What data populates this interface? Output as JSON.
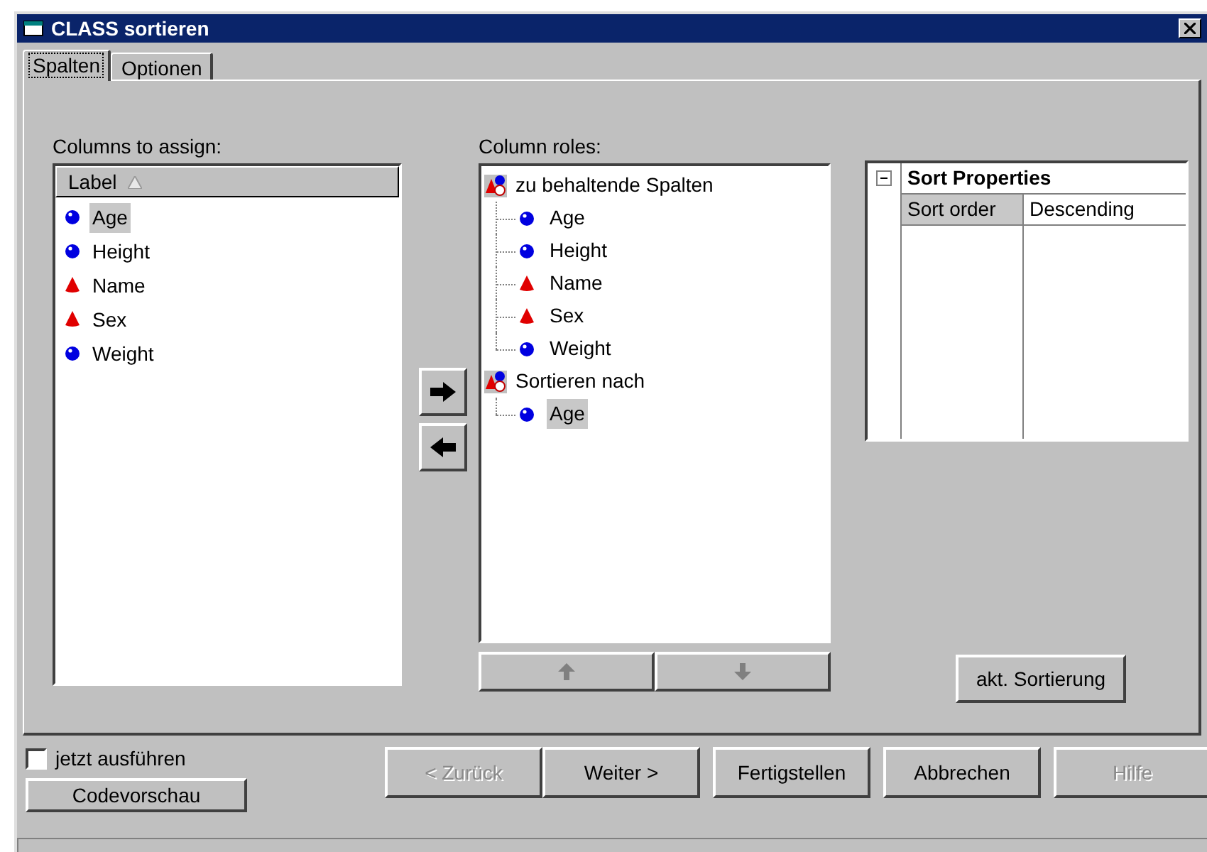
{
  "window": {
    "title": "CLASS sortieren"
  },
  "tabs": [
    {
      "label": "Spalten",
      "selected": true
    },
    {
      "label": "Optionen",
      "selected": false
    }
  ],
  "columns_to_assign": {
    "label": "Columns to assign:",
    "header": "Label",
    "items": [
      {
        "label": "Age",
        "kind": "numeric",
        "selected": true
      },
      {
        "label": "Height",
        "kind": "numeric",
        "selected": false
      },
      {
        "label": "Name",
        "kind": "character",
        "selected": false
      },
      {
        "label": "Sex",
        "kind": "character",
        "selected": false
      },
      {
        "label": "Weight",
        "kind": "numeric",
        "selected": false
      }
    ]
  },
  "column_roles": {
    "label": "Column roles:",
    "groups": [
      {
        "label": "zu behaltende Spalten",
        "children": [
          {
            "label": "Age",
            "kind": "numeric",
            "selected": false
          },
          {
            "label": "Height",
            "kind": "numeric",
            "selected": false
          },
          {
            "label": "Name",
            "kind": "character",
            "selected": false
          },
          {
            "label": "Sex",
            "kind": "character",
            "selected": false
          },
          {
            "label": "Weight",
            "kind": "numeric",
            "selected": false
          }
        ]
      },
      {
        "label": "Sortieren nach",
        "children": [
          {
            "label": "Age",
            "kind": "numeric",
            "selected": true
          }
        ]
      }
    ]
  },
  "order_buttons": [
    {
      "kind": "up",
      "disabled": true
    },
    {
      "kind": "down",
      "disabled": true
    }
  ],
  "properties": {
    "group": "Sort Properties",
    "expanded": true,
    "rows": [
      {
        "name": "Sort order",
        "value": "Descending"
      }
    ]
  },
  "current_sort_button": "akt. Sortierung",
  "run_now": {
    "label": "jetzt ausführen",
    "checked": false
  },
  "preview_button": "Codevorschau",
  "nav_buttons": [
    {
      "label": "< Zurück",
      "disabled": true
    },
    {
      "label": "Weiter >",
      "disabled": false
    },
    {
      "label": "Fertigstellen",
      "disabled": false
    },
    {
      "label": "Abbrechen",
      "disabled": false
    },
    {
      "label": "Hilfe",
      "disabled": true
    }
  ]
}
